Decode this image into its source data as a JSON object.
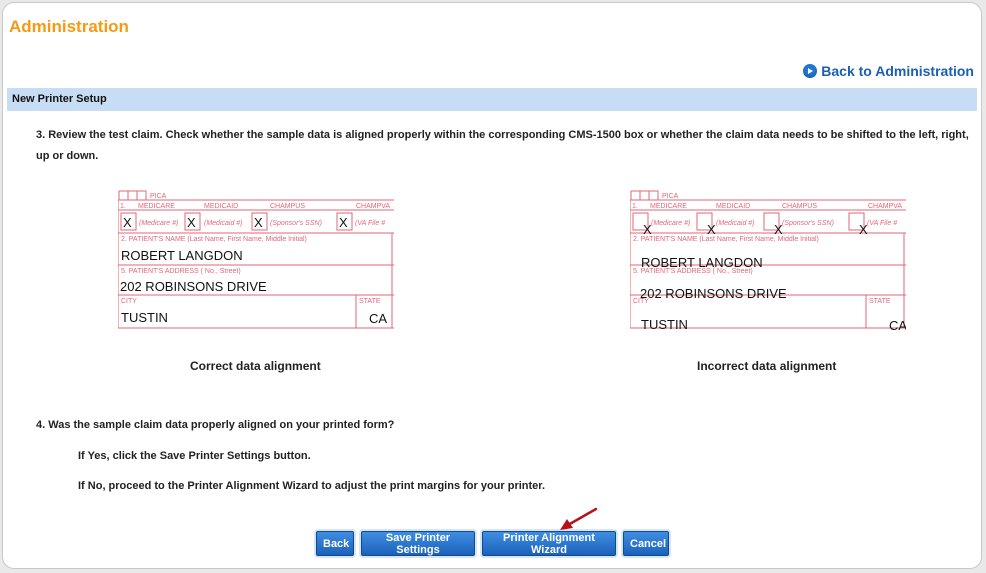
{
  "page": {
    "title": "Administration",
    "back_link": "Back to Administration",
    "section": "New Printer Setup"
  },
  "step3": "3. Review the test claim. Check whether the sample data is aligned properly within the corresponding CMS-1500 box or whether the claim data needs to be shifted to the left, right, up or down.",
  "form": {
    "pica": "PICA",
    "medicare_num": "1.",
    "medicare": "MEDICARE",
    "medicaid": "MEDICAID",
    "champus": "CHAMPUS",
    "champva": "CHAMPVA",
    "medicare_hash": "(Medicare #)",
    "medicaid_hash": "(Medicaid #)",
    "sponsor_ssn": "(Sponsor's SSN)",
    "va_file": "(VA File #",
    "x": "X",
    "patient_name_label": "2. PATIENT'S NAME (Last Name, First Name, Middle Initial)",
    "patient_name": "ROBERT LANGDON",
    "address_label": "5. PATIENT'S ADDRESS ( No., Street)",
    "address": "202 ROBINSONS DRIVE",
    "city_label": "CITY",
    "city": "TUSTIN",
    "state_label": "STATE",
    "state": "CA"
  },
  "captions": {
    "correct": "Correct data alignment",
    "incorrect": "Incorrect data alignment"
  },
  "step4": {
    "question": "4. Was the sample claim data properly aligned on your printed form?",
    "yes": "If Yes, click the Save Printer Settings button.",
    "no": "If No, proceed to the Printer Alignment Wizard to adjust the print margins for your printer."
  },
  "buttons": {
    "back": "Back",
    "save": "Save Printer Settings",
    "wizard": "Printer Alignment Wizard",
    "cancel": "Cancel"
  },
  "colors": {
    "title": "#f59a12",
    "link": "#1a5fb4",
    "section_bar": "#c6ddf5",
    "form_lines": "#e0677a",
    "button": "#2a74cf",
    "arrow": "#b3121b"
  }
}
